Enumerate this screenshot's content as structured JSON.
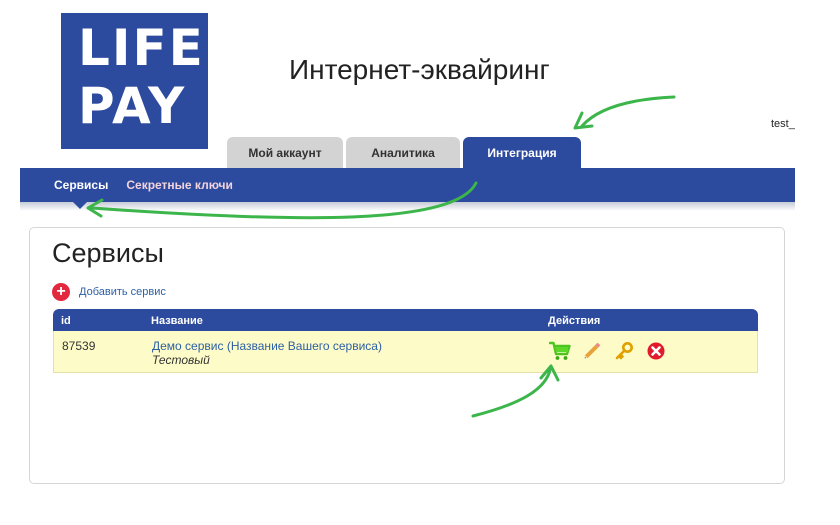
{
  "logo": {
    "line1": "LIFE",
    "line2": "PAY"
  },
  "header": {
    "title": "Интернет-эквайринг",
    "user": "test_"
  },
  "tabs": [
    {
      "label": "Мой аккаунт",
      "active": false
    },
    {
      "label": "Аналитика",
      "active": false
    },
    {
      "label": "Интеграция",
      "active": true
    }
  ],
  "subnav": {
    "items": [
      {
        "label": "Сервисы",
        "active": true
      },
      {
        "label": "Секретные ключи",
        "active": false
      }
    ]
  },
  "main": {
    "title": "Сервисы",
    "add_label": "Добавить сервис",
    "table": {
      "columns": [
        "id",
        "Название",
        "Действия"
      ],
      "rows": [
        {
          "id": "87539",
          "name": "Демо сервис (Название Вашего сервиса)",
          "type": "Тестовый",
          "actions": [
            "cart-icon",
            "pencil-icon",
            "key-icon",
            "delete-icon"
          ]
        }
      ]
    }
  },
  "colors": {
    "brand": "#2c4a9e",
    "row_highlight": "#fdfcc8",
    "link": "#2d5fa5",
    "add": "#e2283e",
    "annotation_arrow": "#3cb54a"
  }
}
